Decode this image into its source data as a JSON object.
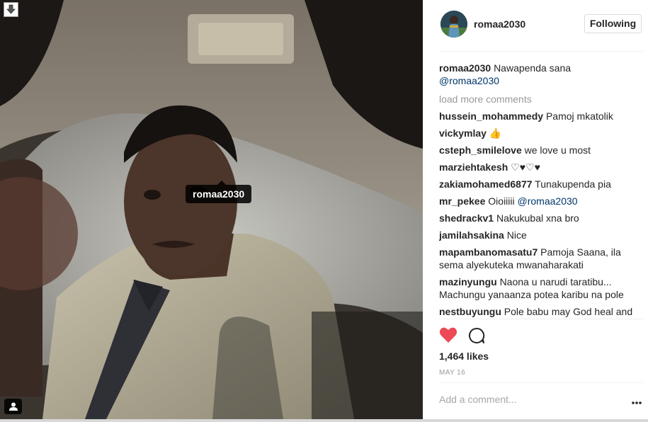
{
  "post": {
    "author": "romaa2030",
    "follow_label": "Following",
    "photo_tag": "romaa2030",
    "caption": {
      "user": "romaa2030",
      "text": "Nawapenda sana",
      "mention": "@romaa2030"
    },
    "load_more": "load more comments",
    "comments": [
      {
        "user": "hussein_mohammedy",
        "text": "Pamoj mkatolik"
      },
      {
        "user": "vickymlay",
        "text": "👍"
      },
      {
        "user": "csteph_smilelove",
        "text": "we love u most"
      },
      {
        "user": "marziehtakesh",
        "text": "♡♥♡♥"
      },
      {
        "user": "zakiamohamed6877",
        "text": "Tunakupenda pia"
      },
      {
        "user": "mr_pekee",
        "text": "Oioiiiii @romaa2030"
      },
      {
        "user": "shedrackv1",
        "text": "Nakukubal xna bro"
      },
      {
        "user": "jamilahsakina",
        "text": "Nice"
      },
      {
        "user": "mapambanomasatu7",
        "text": "Pamoja Saana, ila sema alyekuteka mwanaharakati"
      },
      {
        "user": "mazinyungu",
        "text": "Naona u narudi taratibu... Machungu yanaanza potea karibu na pole"
      },
      {
        "user": "nestbuyungu",
        "text": "Pole babu may God heal and"
      }
    ],
    "likes": "1,464 likes",
    "date": "MAY 16",
    "add_comment_placeholder": "Add a comment...",
    "liked": true,
    "heart_color": "#ed4956"
  }
}
